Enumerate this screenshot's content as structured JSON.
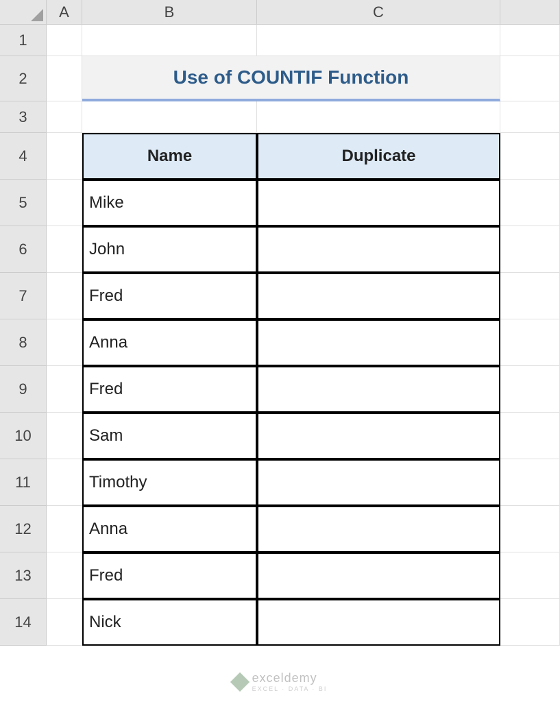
{
  "columns": [
    "A",
    "B",
    "C"
  ],
  "title": "Use of COUNTIF Function",
  "table": {
    "headers": {
      "name": "Name",
      "duplicate": "Duplicate"
    },
    "rows": [
      {
        "name": "Mike",
        "duplicate": ""
      },
      {
        "name": "John",
        "duplicate": ""
      },
      {
        "name": "Fred",
        "duplicate": ""
      },
      {
        "name": "Anna",
        "duplicate": ""
      },
      {
        "name": "Fred",
        "duplicate": ""
      },
      {
        "name": "Sam",
        "duplicate": ""
      },
      {
        "name": "Timothy",
        "duplicate": ""
      },
      {
        "name": "Anna",
        "duplicate": ""
      },
      {
        "name": "Fred",
        "duplicate": ""
      },
      {
        "name": "Nick",
        "duplicate": ""
      }
    ]
  },
  "row_heights": {
    "r1": 46,
    "r2": 66,
    "r3": 46,
    "r4": 68,
    "data": 68
  },
  "row_numbers": [
    "1",
    "2",
    "3",
    "4",
    "5",
    "6",
    "7",
    "8",
    "9",
    "10",
    "11",
    "12",
    "13",
    "14"
  ],
  "watermark": {
    "text": "exceldemy",
    "sub": "EXCEL · DATA · BI"
  }
}
